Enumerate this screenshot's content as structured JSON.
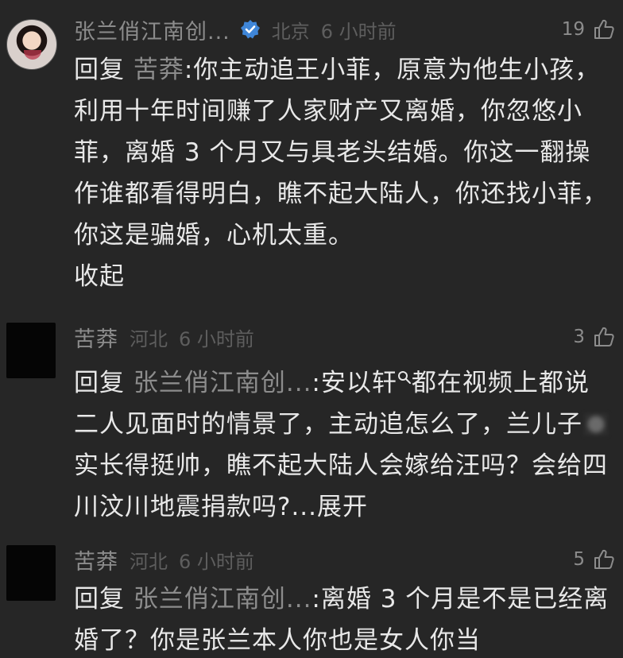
{
  "comments": [
    {
      "username": "张兰俏江南创...",
      "verified": true,
      "location": "北京",
      "time": "6 小时前",
      "likes": "19",
      "reply_prefix": "回复",
      "reply_target": "苦莽",
      "text": ":你主动追王小菲，原意为他生小孩，利用十年时间赚了人家财产又离婚，你忽悠小菲，离婚 3 个月又与具老头结婚。你这一翻操作谁都看得明白，瞧不起大陆人，你还找小菲，你这是骗婚，心机太重。",
      "collapse_label": "收起"
    },
    {
      "username": "苦莽",
      "location": "河北",
      "time": "6 小时前",
      "likes": "3",
      "reply_prefix": "回复",
      "reply_target": "张兰俏江南创...",
      "text_part1": ":安以轩",
      "text_part2": "都在视频上都说二人见面时的情景了，主动追怎么了，兰儿子",
      "text_part3": "实长得挺帅，瞧不起大陆人会嫁给汪吗？会给四川汶川地震捐款吗?...",
      "expand_label": "展开"
    },
    {
      "username": "苦莽",
      "location": "河北",
      "time": "6 小时前",
      "likes": "5",
      "reply_prefix": "回复",
      "reply_target": "张兰俏江南创...",
      "text": ":离婚 3 个月是不是已经离婚了？你是张兰本人你也是女人你当"
    }
  ]
}
